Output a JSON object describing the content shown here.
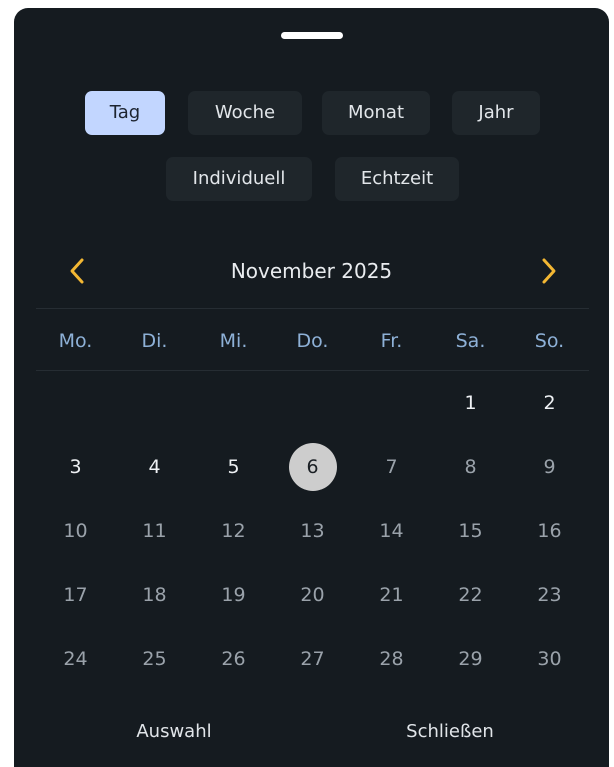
{
  "periods": {
    "row1": [
      {
        "label": "Tag",
        "active": true
      },
      {
        "label": "Woche",
        "active": false
      },
      {
        "label": "Monat",
        "active": false
      },
      {
        "label": "Jahr",
        "active": false
      }
    ],
    "row2": [
      {
        "label": "Individuell",
        "active": false
      },
      {
        "label": "Echtzeit",
        "active": false
      }
    ]
  },
  "calendar": {
    "month_title": "November 2025",
    "weekdays": [
      "Mo.",
      "Di.",
      "Mi.",
      "Do.",
      "Fr.",
      "Sa.",
      "So."
    ],
    "weeks": [
      [
        "",
        "",
        "",
        "",
        "",
        "1",
        "2"
      ],
      [
        "3",
        "4",
        "5",
        "6",
        "7",
        "8",
        "9"
      ],
      [
        "10",
        "11",
        "12",
        "13",
        "14",
        "15",
        "16"
      ],
      [
        "17",
        "18",
        "19",
        "20",
        "21",
        "22",
        "23"
      ],
      [
        "24",
        "25",
        "26",
        "27",
        "28",
        "29",
        "30"
      ]
    ],
    "selected_day": "6"
  },
  "footer": {
    "select_label": "Auswahl",
    "close_label": "Schließen"
  },
  "icons": {
    "prev": "chevron-left-icon",
    "next": "chevron-right-icon"
  },
  "colors": {
    "background": "#151b20",
    "accent": "#f3b733",
    "active_chip": "#c2d6ff",
    "weekday_text": "#8eb1d7",
    "selected_day": "#cdcdcd"
  }
}
